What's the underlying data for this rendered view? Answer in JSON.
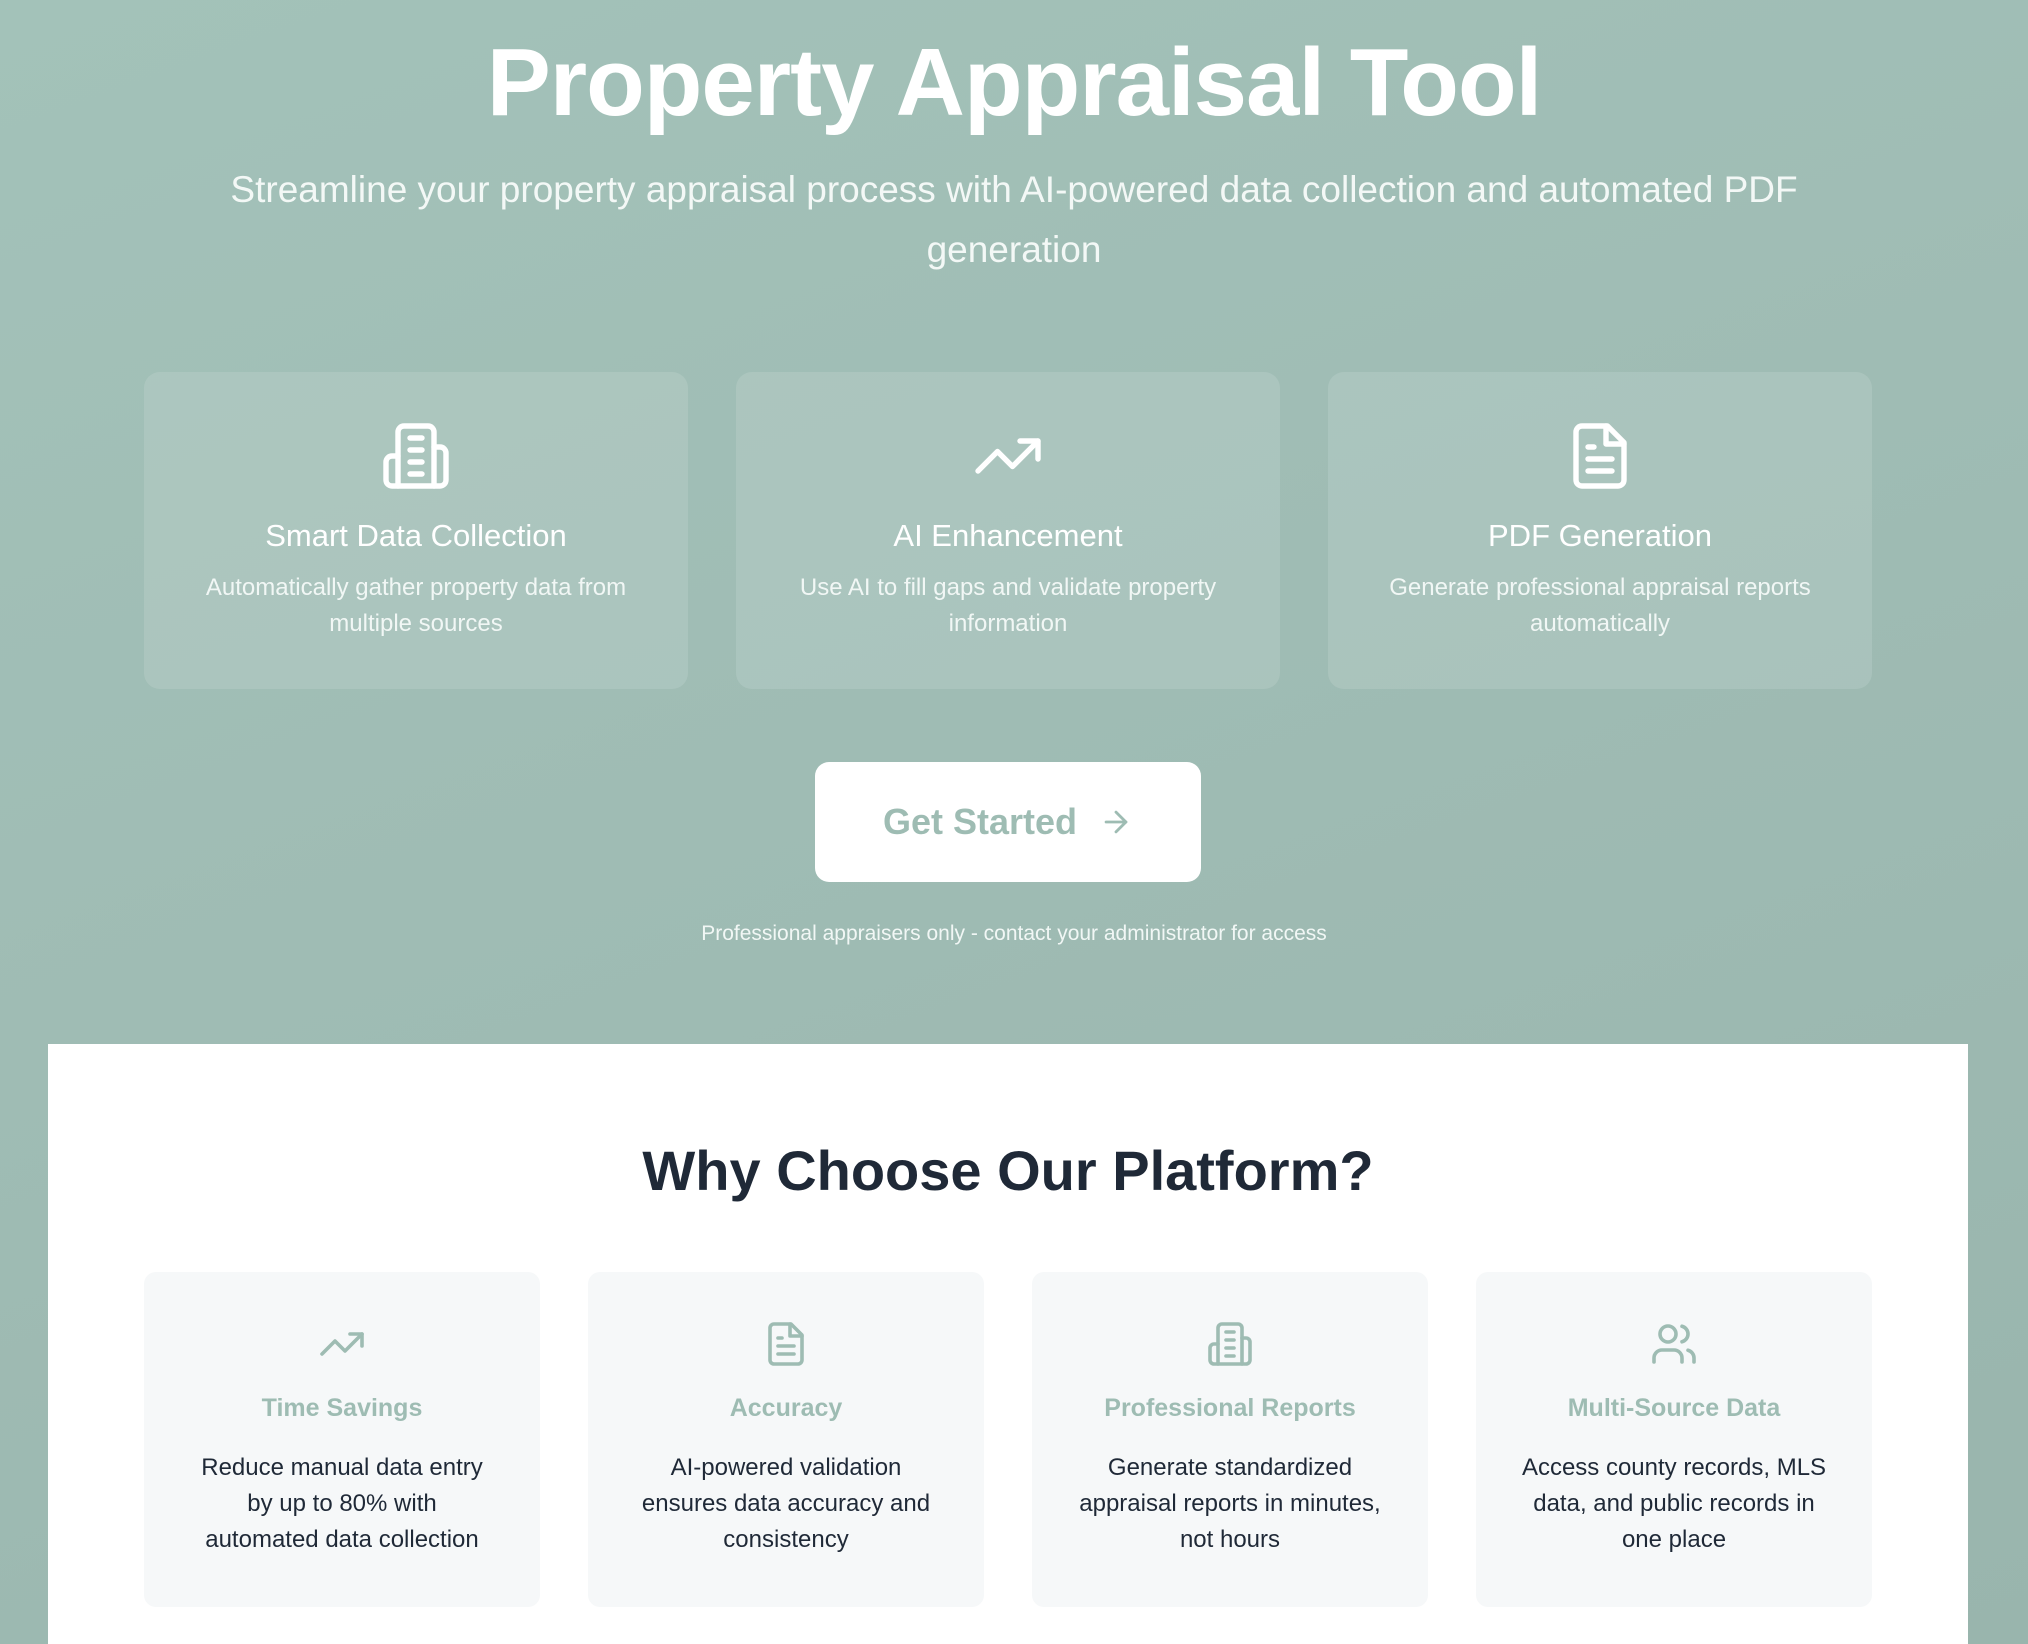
{
  "hero": {
    "title": "Property Appraisal Tool",
    "subtitle": "Streamline your property appraisal process with AI-powered data collection and automated PDF generation"
  },
  "features": [
    {
      "icon": "building-icon",
      "title": "Smart Data Collection",
      "description": "Automatically gather property data from multiple sources"
    },
    {
      "icon": "trending-up-icon",
      "title": "AI Enhancement",
      "description": "Use AI to fill gaps and validate property information"
    },
    {
      "icon": "document-icon",
      "title": "PDF Generation",
      "description": "Generate professional appraisal reports automatically"
    }
  ],
  "cta": {
    "label": "Get Started",
    "icon": "arrow-right-icon"
  },
  "access_note": "Professional appraisers only - contact your administrator for access",
  "why": {
    "title": "Why Choose Our Platform?",
    "benefits": [
      {
        "icon": "trending-up-icon",
        "title": "Time Savings",
        "description": "Reduce manual data entry by up to 80% with automated data collection"
      },
      {
        "icon": "document-icon",
        "title": "Accuracy",
        "description": "AI-powered validation ensures data accuracy and consistency"
      },
      {
        "icon": "building-icon",
        "title": "Professional Reports",
        "description": "Generate standardized appraisal reports in minutes, not hours"
      },
      {
        "icon": "users-icon",
        "title": "Multi-Source Data",
        "description": "Access county records, MLS data, and public records in one place"
      }
    ]
  },
  "colors": {
    "background": "#9fbcb4",
    "accent": "#9ebcb3",
    "heading_dark": "#1f2937",
    "card_light": "#f6f8f9"
  }
}
